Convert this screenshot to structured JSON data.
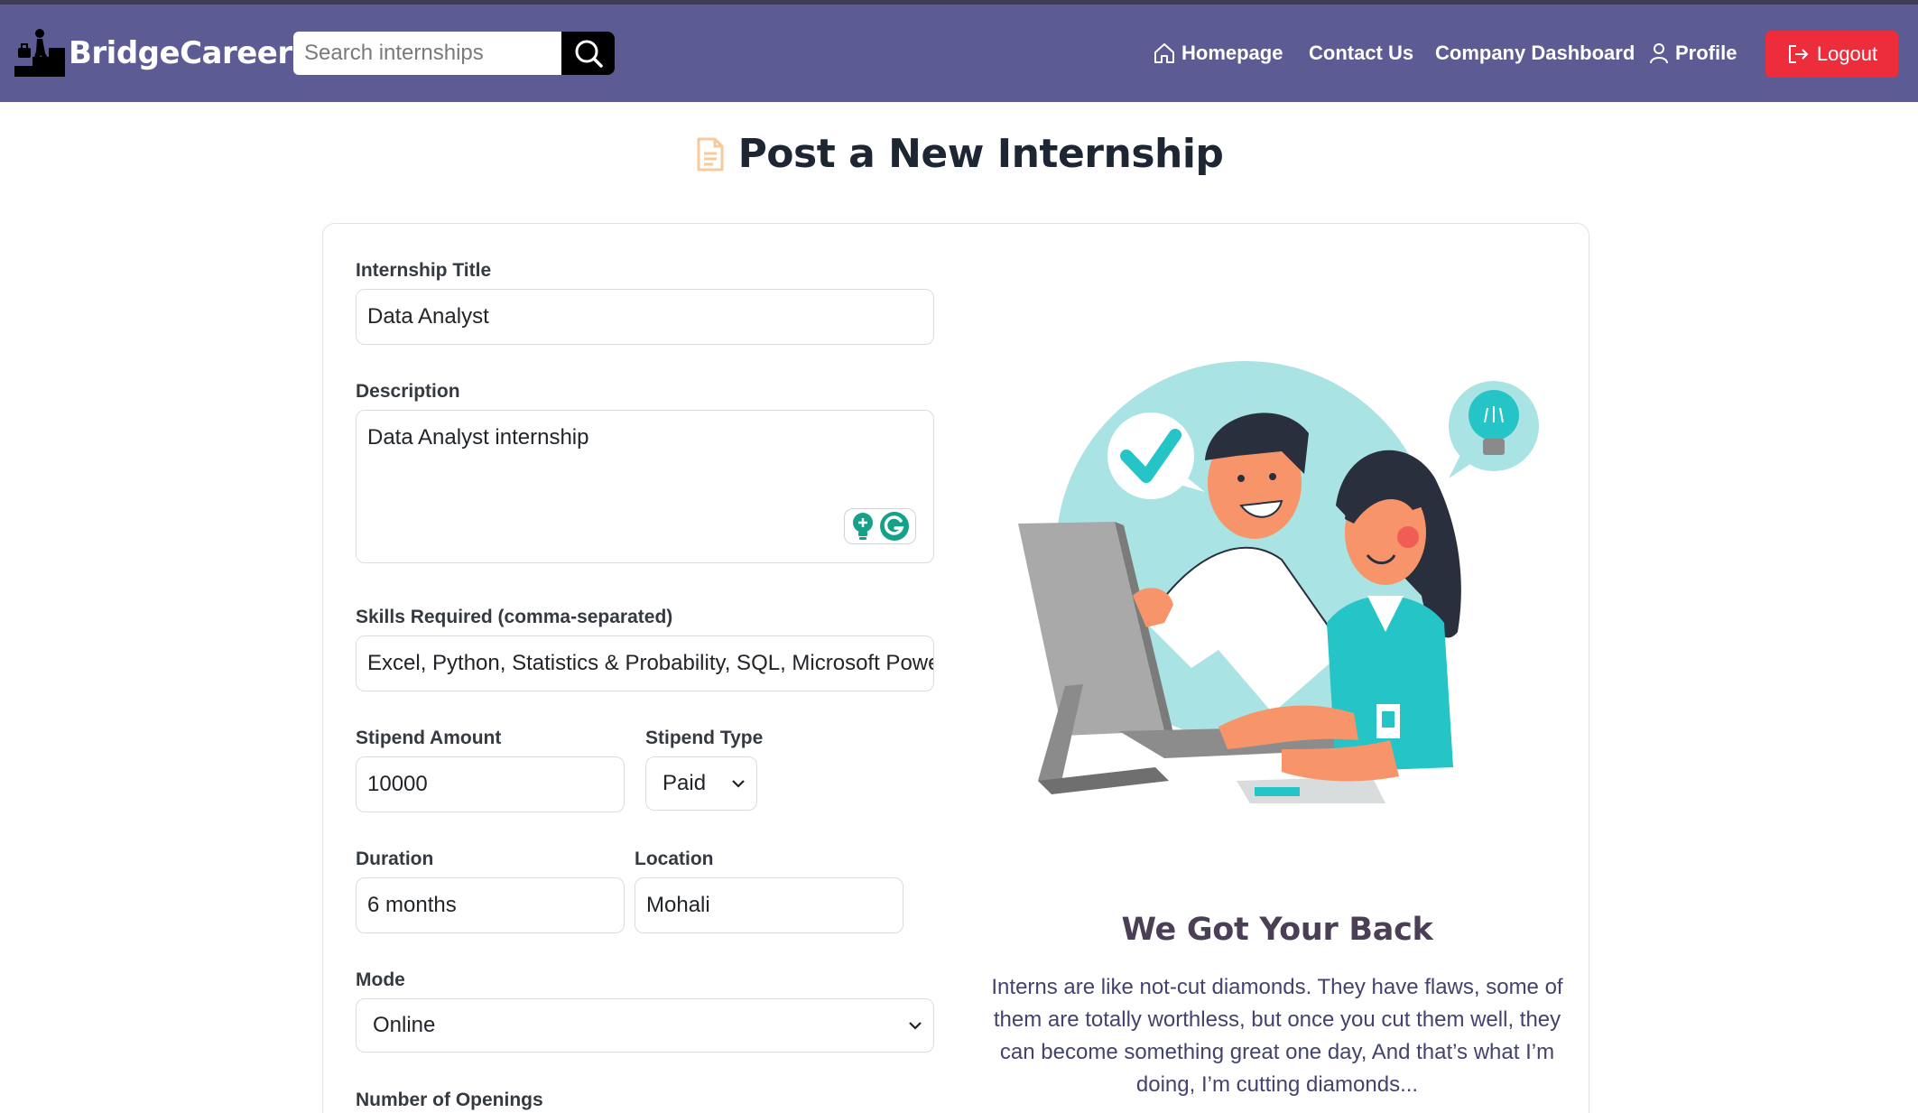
{
  "navbar": {
    "brand": "BridgeCareer",
    "search_placeholder": "Search internships",
    "links": {
      "homepage": "Homepage",
      "contact": "Contact Us",
      "company_dashboard": "Company Dashboard",
      "profile": "Profile"
    },
    "logout": "Logout",
    "colors": {
      "bar": "#5d5b94",
      "logout": "#ee2d3c"
    }
  },
  "page": {
    "title": "Post a New Internship",
    "title_icon": "document-icon"
  },
  "form": {
    "title_label": "Internship Title",
    "title_value": "Data Analyst",
    "description_label": "Description",
    "description_value": "Data Analyst internship",
    "skills_label": "Skills Required (comma-separated)",
    "skills_value": "Excel, Python,  Statistics & Probability,  SQL, Microsoft Power BI",
    "stipend_amount_label": "Stipend Amount",
    "stipend_amount_value": "10000",
    "stipend_type_label": "Stipend Type",
    "stipend_type_value": "Paid",
    "duration_label": "Duration",
    "duration_value": "6 months",
    "location_label": "Location",
    "location_value": "Mohali",
    "mode_label": "Mode",
    "mode_value": "Online",
    "openings_label": "Number of Openings"
  },
  "side": {
    "heading": "We Got Your Back",
    "text": "Interns are like not-cut diamonds. They have flaws, some of them are totally worthless, but once you cut them well, they can become something great one day, And that’s what I’m doing, I’m cutting diamonds..."
  }
}
